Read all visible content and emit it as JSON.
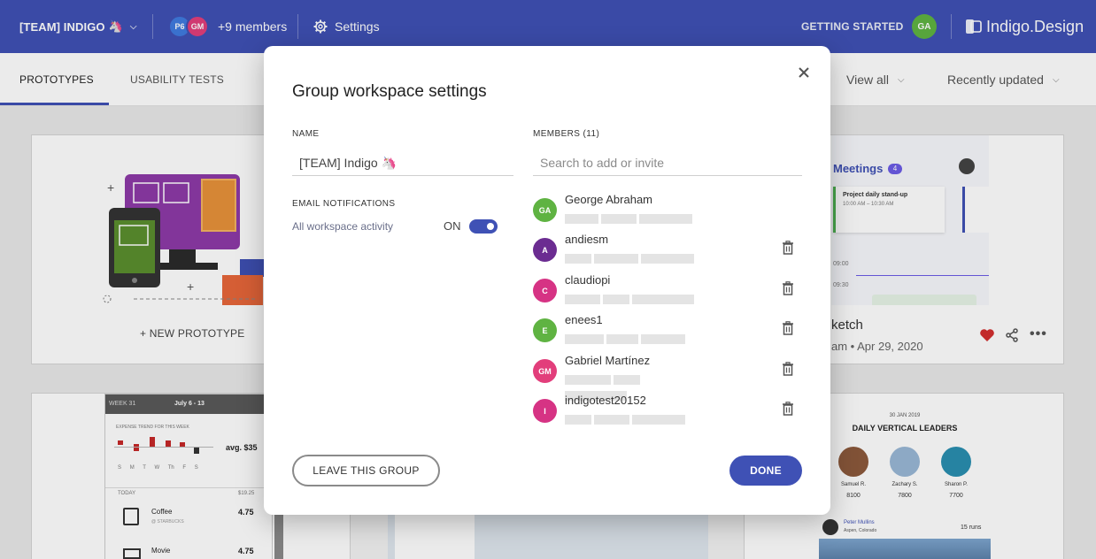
{
  "topbar": {
    "team_name": "[TEAM] INDIGO",
    "members": [
      {
        "initials": "P6",
        "color": "#3f7be0"
      },
      {
        "initials": "GM",
        "color": "#e23e7b"
      }
    ],
    "members_more": "+9 members",
    "settings_label": "Settings",
    "getting_started": "GETTING STARTED",
    "user_initials": "GA",
    "brand": "Indigo.Design"
  },
  "subnav": {
    "tabs": [
      "PROTOTYPES",
      "USABILITY TESTS"
    ],
    "view_filter": "View all",
    "sort_filter": "Recently updated"
  },
  "cards": {
    "new_prototype": "+ NEW PROTOTYPE",
    "sketch_title": "ketch",
    "sketch_meta": "am • Apr 29, 2020",
    "meetings_label": "Meetings",
    "meetings_count": "4",
    "standup_title": "Project daily stand-up",
    "standup_time": "10:00 AM – 10:30 AM",
    "time_0900": "09:00",
    "time_0930": "09:30",
    "week": "WEEK 31",
    "date_range": "July 6 - 13",
    "expense_trend": "EXPENSE TREND FOR THIS WEEK",
    "avg_label": "avg. $35",
    "days": [
      "S",
      "M",
      "T",
      "W",
      "Th",
      "F",
      "S"
    ],
    "today_label": "TODAY",
    "today_total": "$19.25",
    "expenses": [
      {
        "name": "Coffee",
        "sub": "@ STARBUCKS",
        "amount": "4.75"
      },
      {
        "name": "Movie",
        "sub": "",
        "amount": "4.75"
      }
    ],
    "leaders_date": "30 JAN 2019",
    "leaders_title": "DAILY VERTICAL LEADERS",
    "leaders": [
      {
        "name": "Samuel R.",
        "score": "8100"
      },
      {
        "name": "Zachary S.",
        "score": "7800"
      },
      {
        "name": "Sharon P.",
        "score": "7700"
      }
    ],
    "runner_name": "Peter Mullins",
    "runner_place": "Aspen, Colorado",
    "runs": "15 runs"
  },
  "modal": {
    "title": "Group workspace settings",
    "name_label": "NAME",
    "name_value": "[TEAM] Indigo 🦄",
    "email_label": "EMAIL NOTIFICATIONS",
    "activity_label": "All workspace activity",
    "toggle_state": "ON",
    "members_label": "MEMBERS (11)",
    "search_placeholder": "Search to add or invite",
    "members": [
      {
        "name": "George Abraham",
        "initials": "GA",
        "color": "#5fb342",
        "removable": false
      },
      {
        "name": "andiesm",
        "initials": "A",
        "color": "#6b2c91",
        "removable": true
      },
      {
        "name": "claudiopi",
        "initials": "C",
        "color": "#d63384",
        "removable": true
      },
      {
        "name": "enees1",
        "initials": "E",
        "color": "#5fb342",
        "removable": true
      },
      {
        "name": "Gabriel Martínez",
        "initials": "GM",
        "color": "#e23e7b",
        "removable": true
      },
      {
        "name": "indigotest20152",
        "initials": "I",
        "color": "#d63384",
        "removable": true
      }
    ],
    "leave_button": "LEAVE THIS GROUP",
    "done_button": "DONE"
  },
  "colors": {
    "primary": "#3f51b5",
    "heart": "#d32f2f"
  }
}
